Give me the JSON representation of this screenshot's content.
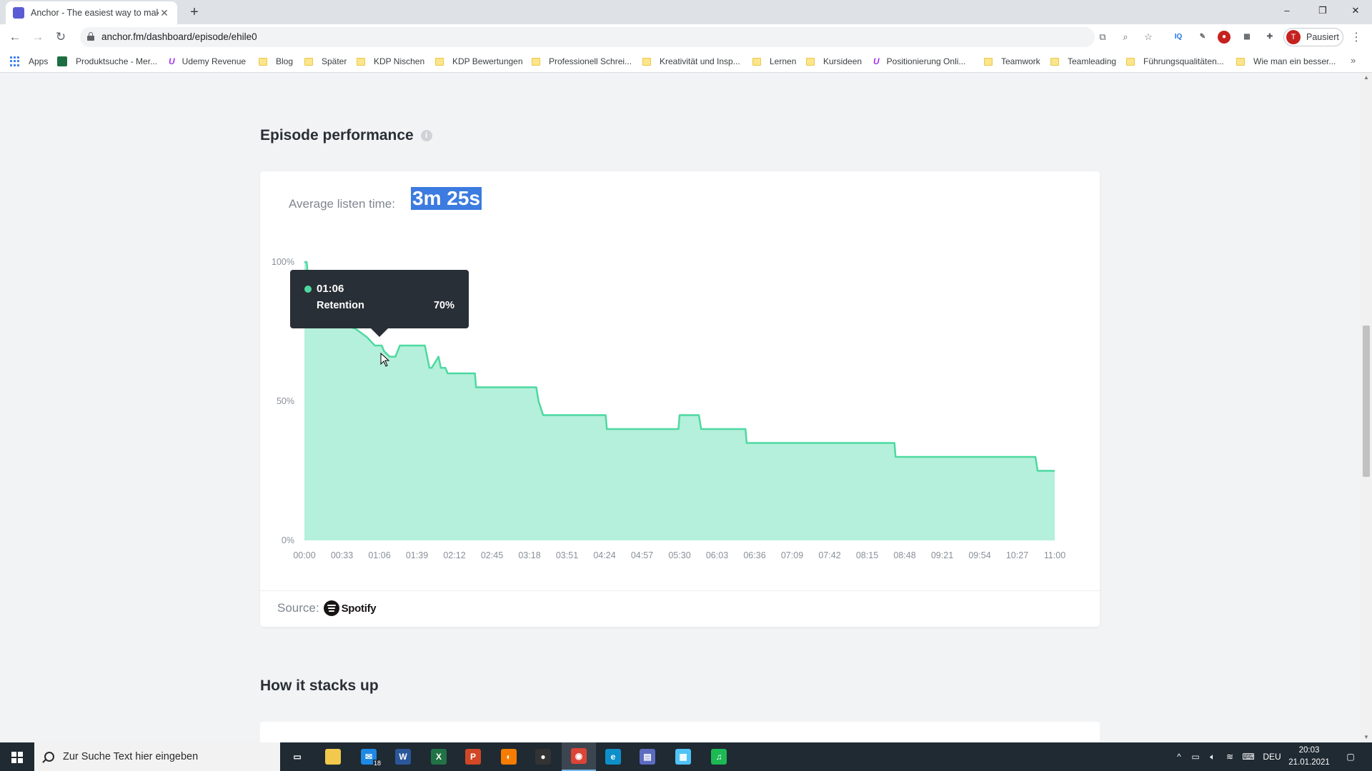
{
  "browser": {
    "tab_title": "Anchor - The easiest way to mak",
    "new_tab": "+",
    "url": "anchor.fm/dashboard/episode/ehile0",
    "profile_initial": "T",
    "profile_status": "Pausiert",
    "window_controls": [
      "–",
      "❐",
      "✕"
    ]
  },
  "bookmarks": [
    {
      "label": "Apps",
      "icon": "apps-icon"
    },
    {
      "label": "Produktsuche - Mer...",
      "icon": "produktsuche-icon"
    },
    {
      "label": "Udemy Revenue",
      "icon": "udemy-icon"
    },
    {
      "label": "Blog",
      "icon": "folder-icon"
    },
    {
      "label": "Später",
      "icon": "folder-icon"
    },
    {
      "label": "KDP Nischen",
      "icon": "folder-icon"
    },
    {
      "label": "KDP Bewertungen",
      "icon": "folder-icon"
    },
    {
      "label": "Professionell Schrei...",
      "icon": "folder-icon"
    },
    {
      "label": "Kreativität und Insp...",
      "icon": "folder-icon"
    },
    {
      "label": "Lernen",
      "icon": "folder-icon"
    },
    {
      "label": "Kursideen",
      "icon": "folder-icon"
    },
    {
      "label": "Positionierung Onli...",
      "icon": "udemy-icon"
    },
    {
      "label": "Teamwork",
      "icon": "folder-icon"
    },
    {
      "label": "Teamleading",
      "icon": "folder-icon"
    },
    {
      "label": "Führungsqualitäten...",
      "icon": "folder-icon"
    },
    {
      "label": "Wie man ein besser...",
      "icon": "folder-icon"
    }
  ],
  "episode_performance": {
    "title": "Episode performance",
    "info": "i",
    "avg_label": "Average listen time:",
    "avg_value": "3m 25s",
    "source_label": "Source:",
    "source_name": "Spotify"
  },
  "tooltip": {
    "time": "01:06",
    "label": "Retention",
    "value": "70%"
  },
  "chart_data": {
    "type": "area",
    "title": "",
    "xlabel": "",
    "ylabel": "",
    "x_ticks": [
      "00:00",
      "00:33",
      "01:06",
      "01:39",
      "02:12",
      "02:45",
      "03:18",
      "03:51",
      "04:24",
      "04:57",
      "05:30",
      "06:03",
      "06:36",
      "07:09",
      "07:42",
      "08:15",
      "08:48",
      "09:21",
      "09:54",
      "10:27",
      "11:00"
    ],
    "y_ticks": [
      "0%",
      "50%",
      "100%"
    ],
    "ylim": [
      0,
      100
    ],
    "xlim_seconds": [
      0,
      660
    ],
    "color": "#4dd9a0",
    "fill": "#b5f0dc",
    "series": [
      {
        "x_seconds": [
          0,
          2,
          3,
          5,
          10,
          20,
          28,
          30,
          45,
          55,
          62,
          66,
          68,
          70,
          75,
          80,
          84,
          86,
          106,
          110,
          112,
          118,
          120,
          124,
          126,
          150,
          151,
          163,
          204,
          206,
          210,
          265,
          266,
          329,
          330,
          347,
          349,
          388,
          389,
          519,
          520,
          643,
          645,
          660
        ],
        "values": [
          100,
          100,
          95,
          92,
          88,
          84,
          80,
          78,
          76,
          73,
          70,
          70,
          70,
          68,
          66,
          66,
          70,
          70,
          70,
          62,
          62,
          66,
          62,
          62,
          60,
          60,
          55,
          55,
          55,
          50,
          45,
          45,
          40,
          40,
          45,
          45,
          40,
          40,
          35,
          35,
          30,
          30,
          25,
          25
        ]
      }
    ]
  },
  "how_it_stacks": {
    "title": "How it stacks up"
  },
  "taskbar": {
    "search_placeholder": "Zur Suche Text hier eingeben",
    "mail_badge": "18",
    "language": "DEU",
    "time": "20:03",
    "date": "21.01.2021",
    "apps": [
      {
        "name": "task-view",
        "glyph": "▭",
        "color": "#1f2a33"
      },
      {
        "name": "file-explorer",
        "glyph": "",
        "color": "#f2c94c"
      },
      {
        "name": "mail",
        "glyph": "✉",
        "color": "#1e88e5"
      },
      {
        "name": "word",
        "glyph": "W",
        "color": "#2b579a"
      },
      {
        "name": "excel",
        "glyph": "X",
        "color": "#217346"
      },
      {
        "name": "powerpoint",
        "glyph": "P",
        "color": "#d24726"
      },
      {
        "name": "app-orange",
        "glyph": "◐",
        "color": "#f57c00"
      },
      {
        "name": "obs",
        "glyph": "●",
        "color": "#333333"
      },
      {
        "name": "chrome",
        "glyph": "◉",
        "color": "#db4437"
      },
      {
        "name": "edge",
        "glyph": "e",
        "color": "#0f8fc9"
      },
      {
        "name": "app-doc",
        "glyph": "▤",
        "color": "#5c6bc0"
      },
      {
        "name": "app-notepad",
        "glyph": "▦",
        "color": "#4fc3f7"
      },
      {
        "name": "spotify",
        "glyph": "♫",
        "color": "#1db954"
      }
    ]
  }
}
